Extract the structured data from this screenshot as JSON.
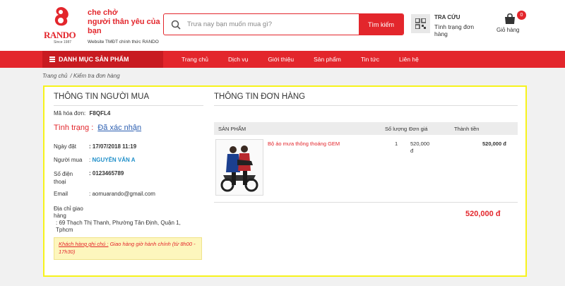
{
  "header": {
    "logo_brand": "RANDO",
    "logo_since": "Since 1987",
    "slogan_line1": "che chở",
    "slogan_line2": "người thân yêu của bạn",
    "slogan_line3": "Website TMĐT chính thức RANDO",
    "search_placeholder": "Trưa nay bạn muốn mua gì?",
    "search_button": "Tìm kiếm",
    "track_title": "TRA CỨU",
    "track_subtitle": "Tình trạng đơn hàng",
    "cart_count": "0",
    "cart_label": "Giỏ hàng"
  },
  "nav": {
    "category_label": "DANH MỤC SẢN PHẨM",
    "items": [
      "Trang chủ",
      "Dịch vụ",
      "Giới thiệu",
      "Sản phẩm",
      "Tin tức",
      "Liên hệ"
    ]
  },
  "breadcrumb": [
    "Trang chủ",
    "/ Kiểm tra đơn hàng"
  ],
  "buyer": {
    "title": "THÔNG TIN NGƯỜI MUA",
    "invoice_label": "Mã hóa đơn:",
    "invoice_value": "F8QFL4",
    "status_label": "Tình trạng :",
    "status_value": "Đã xác nhận",
    "date_label": "Ngày đặt",
    "date_value": ": 17/07/2018 11:19",
    "buyer_label": "Người mua",
    "buyer_value": "NGUYỄN VĂN A",
    "buyer_colon": ":",
    "phone_label": "Số điện thoại",
    "phone_value": ": 0123465789",
    "email_label": "Email",
    "email_value": ": aomuarando@gmail.com",
    "address_label": "Địa chỉ giao hàng",
    "address_value": ": 69 Thạch Thị Thanh, Phường Tân Định, Quận 1, Tphcm",
    "note_label": "Khách hàng ghi chú :",
    "note_value": "Giao hàng giờ hành chính (từ 8h00 - 17h30)"
  },
  "order": {
    "title": "THÔNG TIN ĐƠN HÀNG",
    "columns": {
      "product": "SẢN PHẨM",
      "qty": "Số lượng",
      "price": "Đơn giá",
      "total": "Thành tiền"
    },
    "items": [
      {
        "name": "Bộ áo mưa thông thoáng GEM",
        "qty": "1",
        "price": "520,000 đ",
        "total": "520,000 đ"
      }
    ],
    "grand_total": "520,000 đ"
  },
  "colors": {
    "brand_red": "#e3262c",
    "highlight_yellow": "#f7f31c",
    "link_blue": "#2a5db0"
  }
}
